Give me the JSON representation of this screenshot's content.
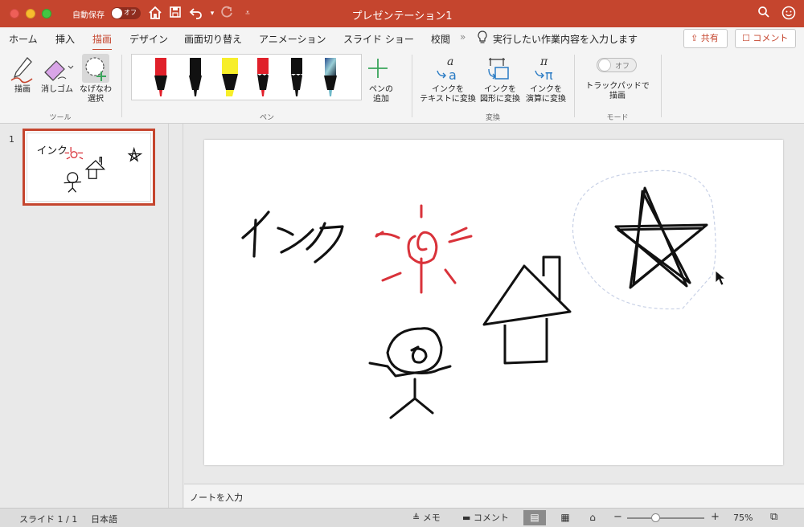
{
  "window": {
    "title": "プレゼンテーション1",
    "autosave_label": "自動保存",
    "autosave_state": "オフ"
  },
  "tabs": [
    "ホーム",
    "挿入",
    "描画",
    "デザイン",
    "画面切り替え",
    "アニメーション",
    "スライド ショー",
    "校閲"
  ],
  "active_tab": "描画",
  "tell_me": "実行したい作業内容を入力します",
  "share_label": "共有",
  "comment_label": "コメント",
  "ribbon": {
    "tools": {
      "group": "ツール",
      "draw": "描画",
      "eraser": "消しゴム",
      "lasso": [
        "なげなわ",
        "選択"
      ]
    },
    "pens": {
      "group": "ペン",
      "add_pen": [
        "ペンの",
        "追加"
      ],
      "colors": [
        "#e0202a",
        "#111111",
        "#f7ee2a",
        "#e0202a",
        "#111111",
        "#4a7fb5"
      ]
    },
    "convert": {
      "group": "変換",
      "to_text": [
        "インクを",
        "テキストに変換"
      ],
      "to_shape": [
        "インクを",
        "図形に変換"
      ],
      "to_math": [
        "インクを",
        "演算に変換"
      ]
    },
    "mode": {
      "group": "モード",
      "trackpad": [
        "トラックパッドで",
        "描画"
      ],
      "toggle": "オフ"
    }
  },
  "slide_panel": {
    "slide_number": "1"
  },
  "slide": {
    "ink_text": "インク"
  },
  "notes_placeholder": "ノートを入力",
  "status": {
    "slide_info": "スライド 1 / 1",
    "language": "日本語",
    "notes": "メモ",
    "comments": "コメント",
    "zoom": "75%"
  },
  "accent_color": "#c5452e"
}
